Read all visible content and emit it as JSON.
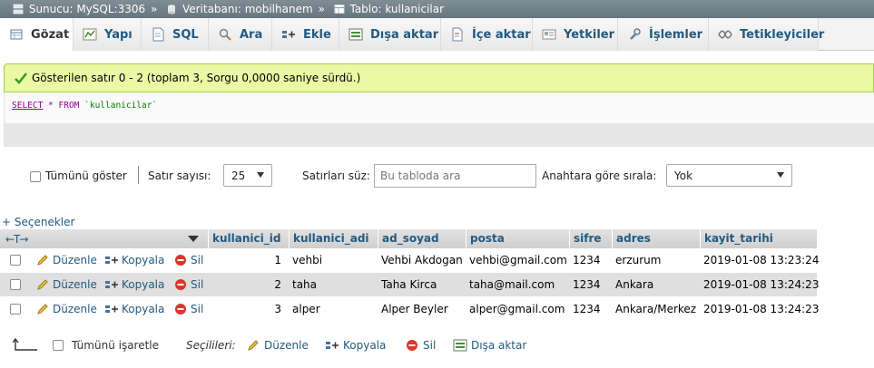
{
  "breadcrumb": {
    "server": "Sunucu: MySQL:3306",
    "database": "Veritabanı: mobilhanem",
    "table": "Tablo: kullanicilar",
    "separator": "»"
  },
  "tabs": [
    {
      "label": "Gözat",
      "icon": "browse-icon",
      "active": true
    },
    {
      "label": "Yapı",
      "icon": "structure-icon"
    },
    {
      "label": "SQL",
      "icon": "sql-icon"
    },
    {
      "label": "Ara",
      "icon": "search-icon"
    },
    {
      "label": "Ekle",
      "icon": "insert-icon"
    },
    {
      "label": "Dışa aktar",
      "icon": "export-icon"
    },
    {
      "label": "İçe aktar",
      "icon": "import-icon"
    },
    {
      "label": "Yetkiler",
      "icon": "privileges-icon"
    },
    {
      "label": "İşlemler",
      "icon": "operations-icon"
    },
    {
      "label": "Tetikleyiciler",
      "icon": "triggers-icon"
    }
  ],
  "message": "Gösterilen satır 0 - 2 (toplam 3, Sorgu 0,0000 saniye sürdü.)",
  "sql": {
    "select": "SELECT",
    "star": " * ",
    "from": "FROM",
    "table": "`kullanicilar`"
  },
  "nav": {
    "show_all": "Tümünü göster",
    "rows_label": "Satır sayısı:",
    "rows_value": "25",
    "filter_label": "Satırları süz:",
    "filter_placeholder": "Bu tabloda ara",
    "sort_label": "Anahtara göre sırala:",
    "sort_value": "Yok"
  },
  "options_label": "+ Seçenekler",
  "arrows_glyph": "←T→",
  "columns": [
    "kullanici_id",
    "kullanici_adi",
    "ad_soyad",
    "posta",
    "sifre",
    "adres",
    "kayit_tarihi"
  ],
  "row_actions": {
    "edit": "Düzenle",
    "copy": "Kopyala",
    "delete": "Sil"
  },
  "rows": [
    {
      "kullanici_id": "1",
      "kullanici_adi": "vehbi",
      "ad_soyad": "Vehbi Akdogan",
      "posta": "vehbi@gmail.com",
      "sifre": "1234",
      "adres": "erzurum",
      "kayit_tarihi": "2019-01-08 13:23:24"
    },
    {
      "kullanici_id": "2",
      "kullanici_adi": "taha",
      "ad_soyad": "Taha Kirca",
      "posta": "taha@mail.com",
      "sifre": "1234",
      "adres": "Ankara",
      "kayit_tarihi": "2019-01-08 13:24:23"
    },
    {
      "kullanici_id": "3",
      "kullanici_adi": "alper",
      "ad_soyad": "Alper Beyler",
      "posta": "alper@gmail.com",
      "sifre": "1234",
      "adres": "Ankara/Merkez",
      "kayit_tarihi": "2019-01-08 13:24:23"
    }
  ],
  "bottom": {
    "check_all": "Tümünü işaretle",
    "with_selected": "Seçilileri:",
    "edit": "Düzenle",
    "copy": "Kopyala",
    "delete": "Sil",
    "export": "Dışa aktar"
  }
}
